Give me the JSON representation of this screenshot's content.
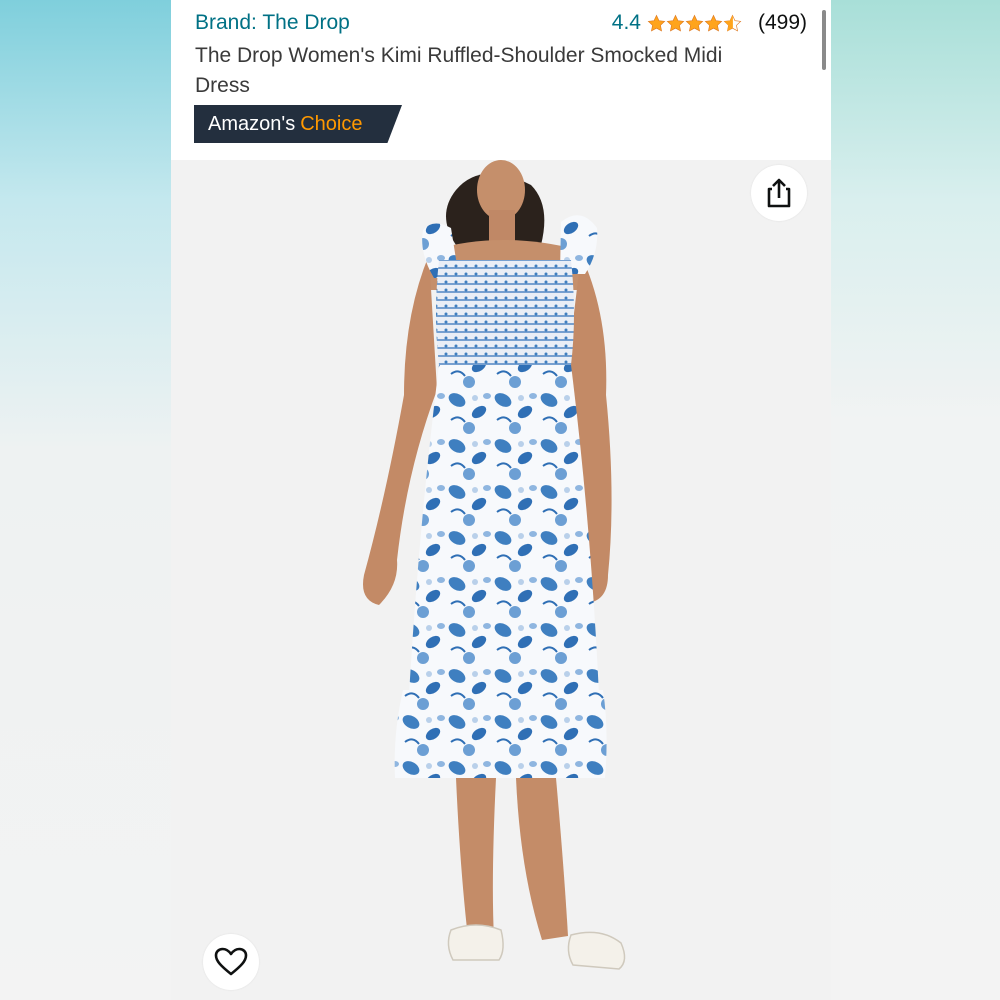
{
  "header": {
    "brand_link": "Brand: The Drop",
    "rating": "4.4",
    "rating_value": 4.4,
    "review_count": "(499)",
    "title": "The Drop Women's Kimi Ruffled-Shoulder Smocked Midi Dress",
    "badge": {
      "prefix": "Amazon's",
      "highlight": "Choice"
    }
  },
  "icons": {
    "share": "share-icon",
    "wishlist": "heart-icon",
    "star_full": "star-icon",
    "star_half": "star-half-icon"
  },
  "colors": {
    "link": "#007185",
    "badge_bg": "#232f3e",
    "badge_accent": "#ff9900",
    "star": "#ffa41c",
    "dress_blue": "#3f7fc0"
  }
}
